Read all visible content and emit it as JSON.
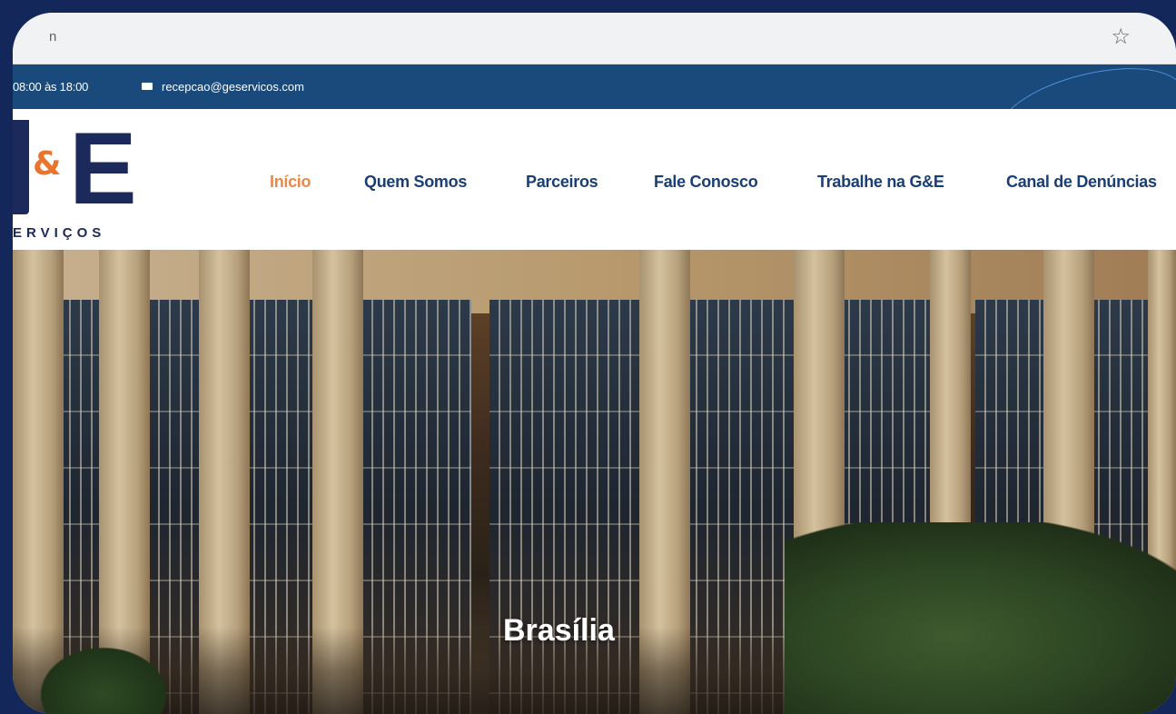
{
  "browser": {
    "url_fragment": "n",
    "bookmark_icon": "star-icon"
  },
  "topbar": {
    "hours": "08:00 às 18:00",
    "email_icon": "mail-icon",
    "email": "recepcao@geservicos.com"
  },
  "logo": {
    "letters_amp": "&",
    "letter_e": "E",
    "subtitle": "ERVIÇOS"
  },
  "nav": {
    "items": [
      {
        "label": "Início",
        "active": true
      },
      {
        "label": "Quem Somos"
      },
      {
        "label": "Parceiros"
      },
      {
        "label": "Fale Conosco"
      },
      {
        "label": "Trabalhe na G&E"
      },
      {
        "label": "Canal de Denúncias"
      }
    ]
  },
  "hero": {
    "caption": "Brasília"
  },
  "colors": {
    "navy": "#1b2a5a",
    "topbar_blue": "#1a4a7c",
    "accent_orange": "#e8752b",
    "nav_text": "#1a3f73"
  }
}
